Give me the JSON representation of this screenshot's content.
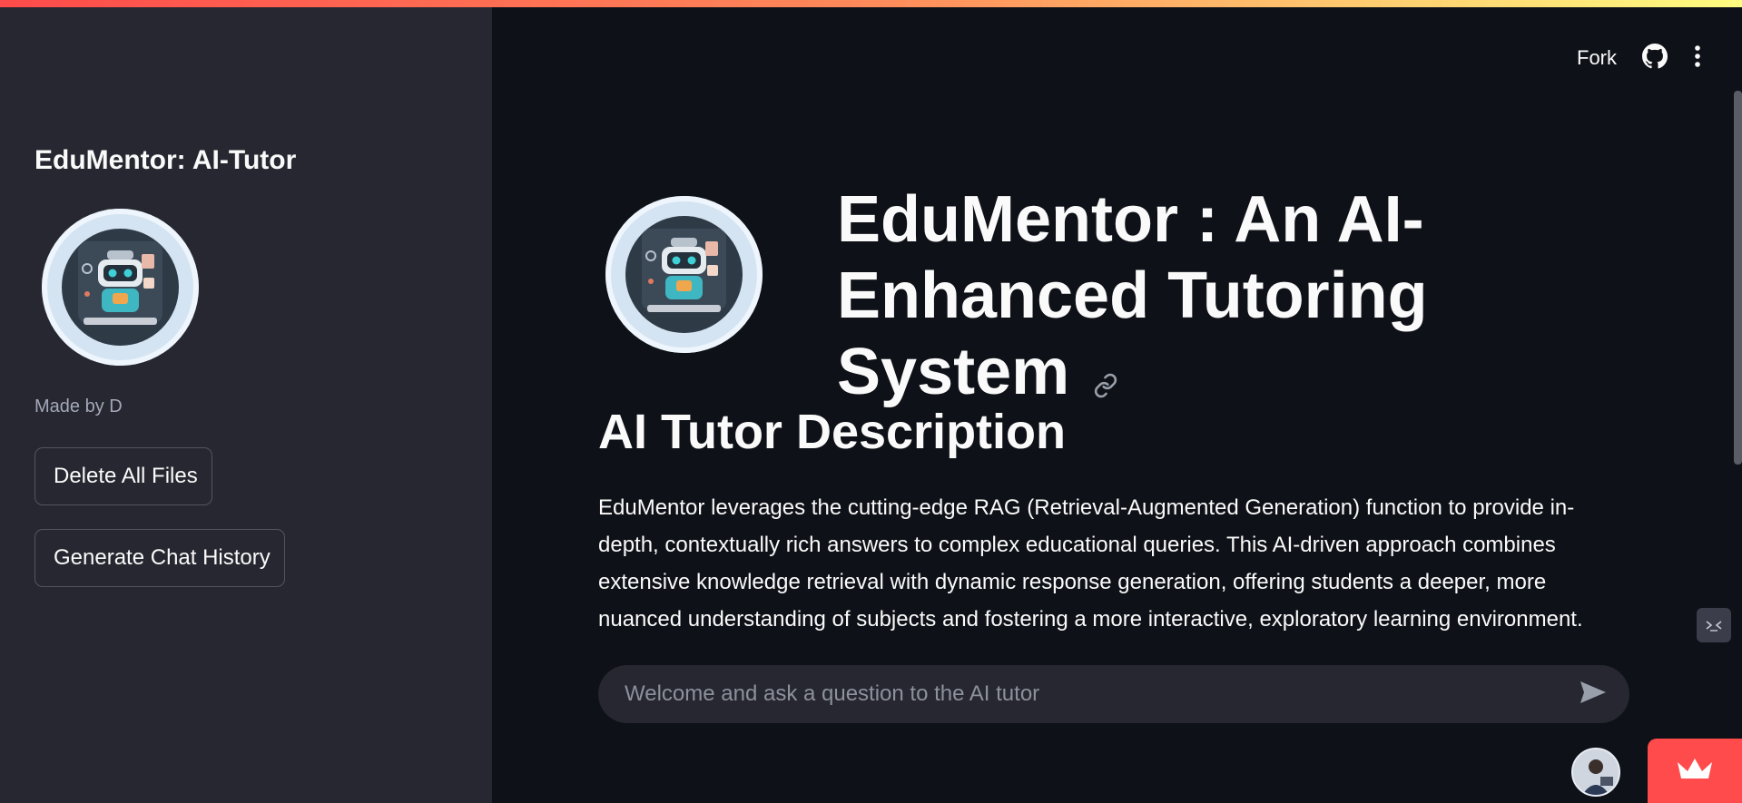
{
  "sidebar": {
    "title": "EduMentor: AI-Tutor",
    "made_by": "Made by D",
    "buttons": {
      "delete_files": "Delete All Files",
      "generate_history": "Generate Chat History"
    }
  },
  "header": {
    "fork_label": "Fork",
    "github_icon": "github-icon",
    "menu_icon": "kebab-menu-icon"
  },
  "main": {
    "title": "EduMentor : An AI-Enhanced Tutoring System",
    "section_heading": "AI Tutor Description",
    "description": "EduMentor leverages the cutting-edge RAG (Retrieval-Augmented Generation) function to provide in-depth, contextually rich answers to complex educational queries. This AI-driven approach combines extensive knowledge retrieval with dynamic response generation, offering students a deeper, more nuanced understanding of subjects and fostering a more interactive, exploratory learning environment."
  },
  "chat": {
    "placeholder": "Welcome and ask a question to the AI tutor",
    "value": ""
  },
  "colors": {
    "background": "#0e1117",
    "sidebar": "#262730",
    "accent": "#ff4b4b",
    "text": "#fafafa"
  }
}
